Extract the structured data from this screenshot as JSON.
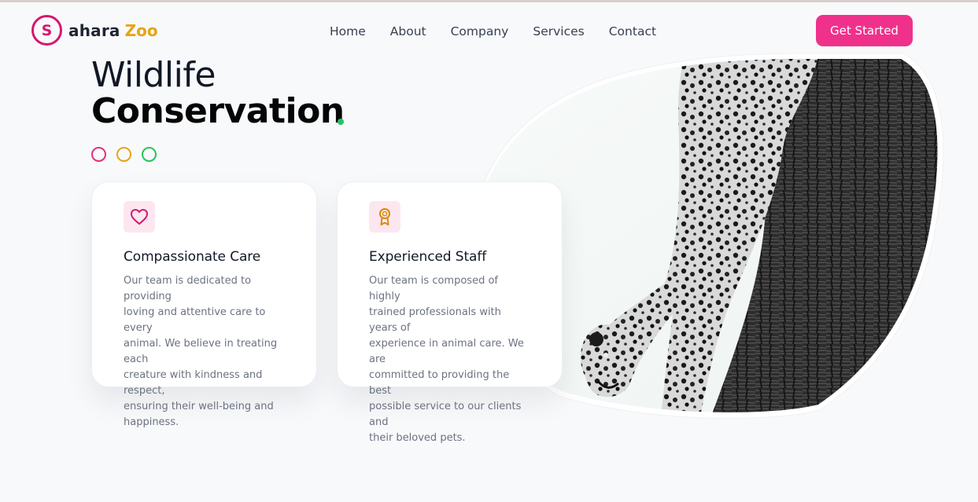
{
  "brand": {
    "initial": "S",
    "name": "ahara",
    "accent_word": "Zoo",
    "colors": {
      "primary": "#d6176f",
      "accent": "#e5a516"
    }
  },
  "nav": {
    "items": [
      {
        "label": "Home"
      },
      {
        "label": "About"
      },
      {
        "label": "Company"
      },
      {
        "label": "Services"
      },
      {
        "label": "Contact"
      }
    ],
    "cta_label": "Get Started",
    "cta_color": "#f0318c"
  },
  "hero": {
    "title_line1": "Wildlife",
    "title_line2": "Conservation",
    "dot_color": "#22c55e",
    "indicator_colors": [
      "#e0317b",
      "#e5a516",
      "#22c55e"
    ]
  },
  "features": [
    {
      "icon": "heart-icon",
      "title": "Compassionate Care",
      "lines": [
        "Our team is dedicated to providing",
        "loving and attentive care to every",
        "animal. We believe in treating each",
        "creature with kindness and respect,",
        "ensuring their well-being and",
        "happiness."
      ]
    },
    {
      "icon": "award-icon",
      "title": "Experienced Staff",
      "lines": [
        "Our team is composed of highly",
        "trained professionals with years of",
        "experience in animal care. We are",
        "committed to providing the best",
        "possible service to our clients and",
        "their beloved pets."
      ]
    }
  ],
  "image": {
    "subject": "leopard-photo"
  }
}
